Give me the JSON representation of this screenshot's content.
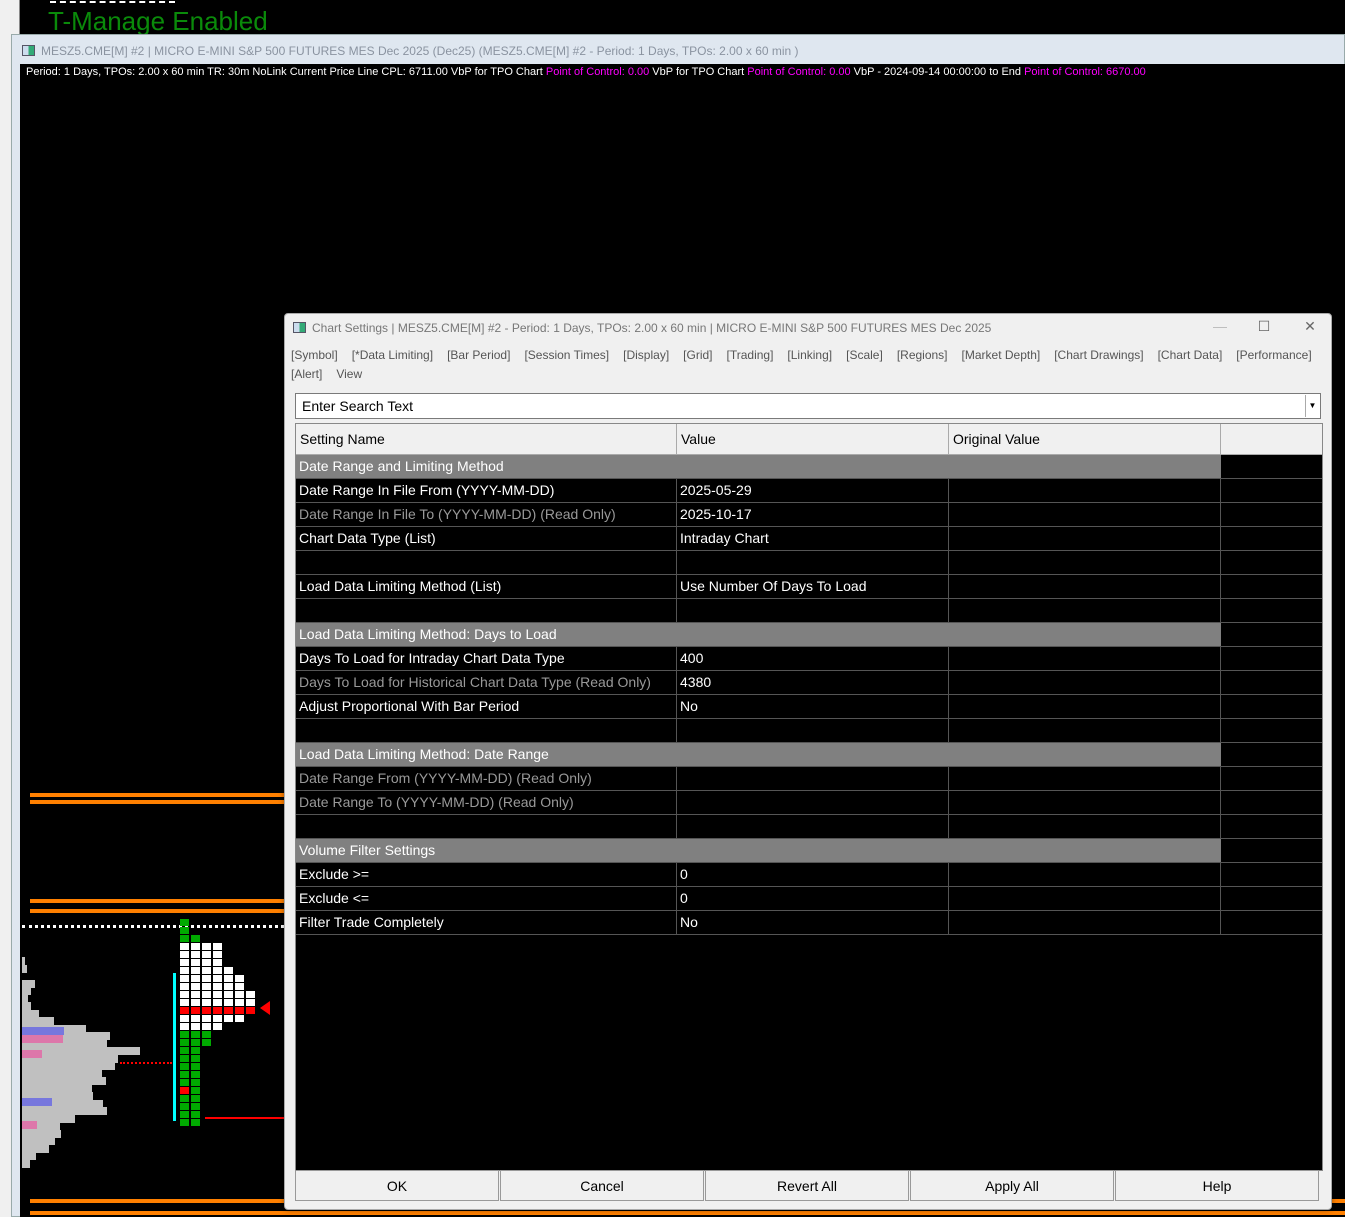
{
  "background": {
    "overlay_text": "T-Manage Enabled"
  },
  "chart_window": {
    "title": "MESZ5.CME[M] #2 | MICRO E-MINI S&P 500 FUTURES MES Dec 2025 (Dec25) (MESZ5.CME[M] #2 - Period: 1 Days, TPOs: 2.00 x 60 min  )",
    "info": {
      "part1": "Period: 1 Days, TPOs: 2.00 x 60 min   TR: 30m NoLink Current Price Line  CPL: 6711.00  VbP for TPO Chart ",
      "poc1": "Point of Control: 0.00",
      "part2": "  VbP for TPO Chart ",
      "poc2": "Point of Control: 0.00",
      "part3": "  VbP - 2024-09-14  00:00:00 to End ",
      "poc3": "Point of Control: 6670.00"
    }
  },
  "dialog": {
    "title": "Chart Settings | MESZ5.CME[M] #2 - Period: 1 Days, TPOs: 2.00 x 60 min   | MICRO E-MINI S&P 500 FUTURES MES Dec 2025",
    "tabs": [
      "[Symbol]",
      "[*Data Limiting]",
      "[Bar Period]",
      "[Session Times]",
      "[Display]",
      "[Grid]",
      "[Trading]",
      "[Linking]",
      "[Scale]",
      "[Regions]",
      "[Market Depth]",
      "[Chart Drawings]",
      "[Chart Data]",
      "[Performance]",
      "[Alert]",
      "View"
    ],
    "search_placeholder": "Enter Search Text",
    "columns": [
      "Setting Name",
      "Value",
      "Original Value"
    ],
    "rows": [
      {
        "type": "group",
        "name": "Date Range and Limiting Method"
      },
      {
        "type": "item",
        "name": "Date Range In File From (YYYY-MM-DD)",
        "value": "2025-05-29"
      },
      {
        "type": "readonly",
        "name": "Date Range In File To (YYYY-MM-DD) (Read Only)",
        "value": "2025-10-17"
      },
      {
        "type": "item",
        "name": "Chart Data Type (List)",
        "value": "Intraday Chart"
      },
      {
        "type": "blank"
      },
      {
        "type": "item",
        "name": "Load Data Limiting Method (List)",
        "value": "Use Number Of Days To Load"
      },
      {
        "type": "blank"
      },
      {
        "type": "group",
        "name": "Load Data Limiting Method: Days to Load"
      },
      {
        "type": "item",
        "name": "Days To Load for Intraday Chart Data Type",
        "value": "400"
      },
      {
        "type": "readonly",
        "name": "Days To Load for Historical Chart Data Type (Read Only)",
        "value": "4380"
      },
      {
        "type": "item",
        "name": "Adjust Proportional With Bar Period",
        "value": "No"
      },
      {
        "type": "blank"
      },
      {
        "type": "group",
        "name": "Load Data Limiting Method: Date Range"
      },
      {
        "type": "readonly",
        "name": "Date Range From (YYYY-MM-DD) (Read Only)",
        "value": ""
      },
      {
        "type": "readonly",
        "name": "Date Range To (YYYY-MM-DD) (Read Only)",
        "value": ""
      },
      {
        "type": "blank"
      },
      {
        "type": "group",
        "name": "Volume Filter Settings"
      },
      {
        "type": "item",
        "name": "Exclude >=",
        "value": "0"
      },
      {
        "type": "item",
        "name": "Exclude <=",
        "value": "0"
      },
      {
        "type": "item",
        "name": "Filter Trade Completely",
        "value": "No"
      }
    ],
    "buttons": [
      "OK",
      "Cancel",
      "Revert All",
      "Apply All",
      "Help"
    ]
  }
}
